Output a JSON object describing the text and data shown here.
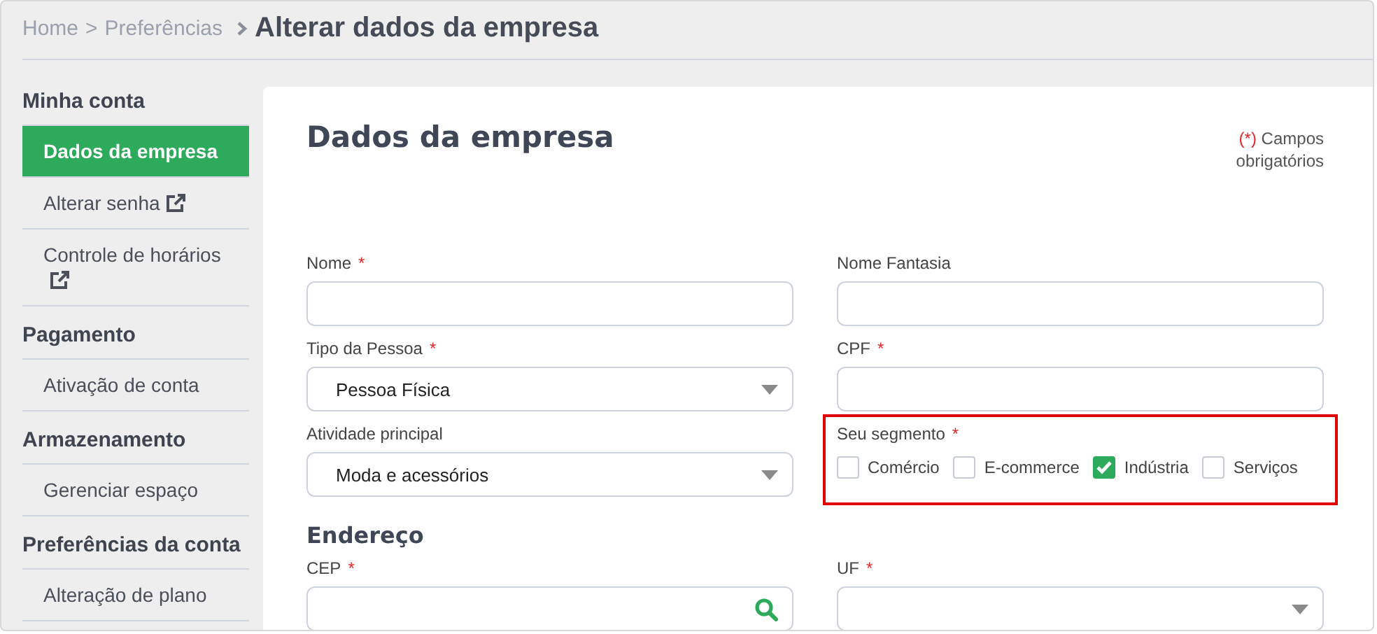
{
  "breadcrumb": {
    "links": [
      {
        "label": "Home"
      },
      {
        "label": "Preferências"
      }
    ],
    "separator": ">",
    "current": "Alterar dados da empresa"
  },
  "sidebar": {
    "sections": [
      {
        "title": "Minha conta",
        "items": [
          {
            "label": "Dados da empresa",
            "selected": true,
            "external": false
          },
          {
            "label": "Alterar senha",
            "selected": false,
            "external": true
          },
          {
            "label": "Controle de horários",
            "selected": false,
            "external": true
          }
        ]
      },
      {
        "title": "Pagamento",
        "items": [
          {
            "label": "Ativação de conta",
            "selected": false,
            "external": false
          }
        ]
      },
      {
        "title": "Armazenamento",
        "items": [
          {
            "label": "Gerenciar espaço",
            "selected": false,
            "external": false
          }
        ]
      },
      {
        "title": "Preferências da conta",
        "items": [
          {
            "label": "Alteração de plano",
            "selected": false,
            "external": false
          }
        ]
      }
    ]
  },
  "content": {
    "title": "Dados da empresa",
    "required_note": {
      "mark": "(*)",
      "text": "Campos obrigatórios"
    },
    "form": [
      {
        "kind": "row",
        "fields": [
          {
            "kind": "text",
            "label": "Nome",
            "required_mark": "*"
          },
          {
            "kind": "text",
            "label": "Nome Fantasia"
          }
        ]
      },
      {
        "kind": "row",
        "fields": [
          {
            "kind": "select",
            "label": "Tipo da Pessoa",
            "required_mark": "*",
            "value": "Pessoa Física"
          },
          {
            "kind": "text",
            "label": "CPF",
            "required_mark": "*"
          }
        ]
      },
      {
        "kind": "row",
        "fields": [
          {
            "kind": "select",
            "label": "Atividade principal",
            "value": "Moda e acessórios"
          },
          {
            "kind": "checkboxes",
            "label": "Seu segmento",
            "required_mark": "*",
            "highlighted": true,
            "options": [
              {
                "label": "Comércio",
                "checked": false
              },
              {
                "label": "E-commerce",
                "checked": false
              },
              {
                "label": "Indústria",
                "checked": true
              },
              {
                "label": "Serviços",
                "checked": false
              }
            ]
          }
        ]
      },
      {
        "kind": "heading",
        "text": "Endereço"
      },
      {
        "kind": "row",
        "fields": [
          {
            "kind": "search",
            "label": "CEP",
            "required_mark": "*"
          },
          {
            "kind": "select",
            "label": "UF",
            "required_mark": "*"
          }
        ]
      }
    ]
  }
}
